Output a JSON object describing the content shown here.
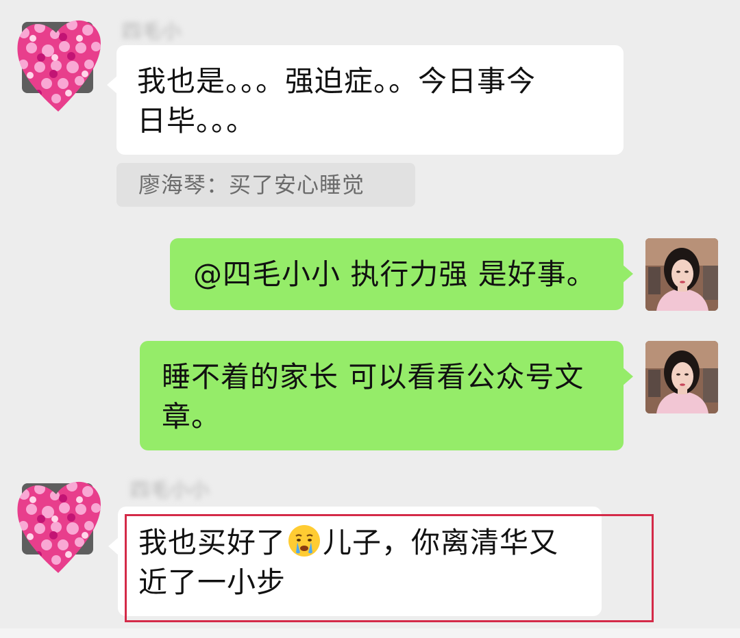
{
  "messages": [
    {
      "sender": "四毛小",
      "text_line1": "我也是。。。强迫症。。今日事今",
      "text_line2": "日毕。。。",
      "quote": "廖海琴：买了安心睡觉"
    },
    {
      "text": "@四毛小小 执行力强 是好事。"
    },
    {
      "text_line1": "睡不着的家长 可以看看公众号文",
      "text_line2": "章。"
    },
    {
      "sender": "四毛小小",
      "text_part1": "我也买好了",
      "emoji": "crying-face-emoji",
      "text_part2": "儿子，你离清华又",
      "text_line2": "近了一小步"
    }
  ],
  "colors": {
    "background": "#ededed",
    "incoming_bubble": "#ffffff",
    "outgoing_bubble": "#95ec69",
    "highlight_border": "#d42a48"
  }
}
